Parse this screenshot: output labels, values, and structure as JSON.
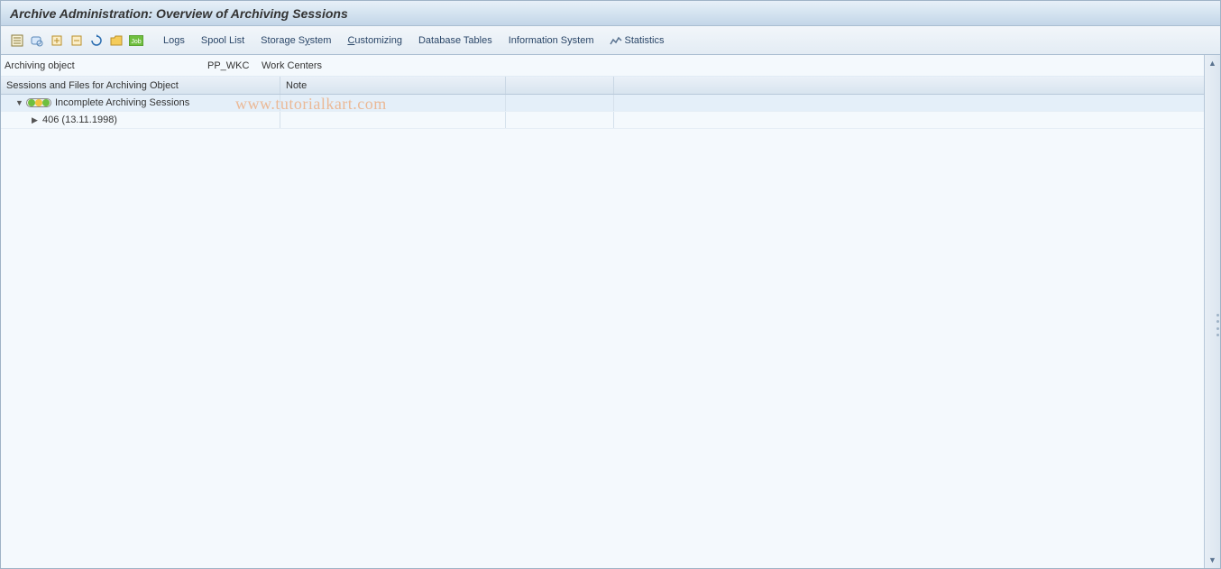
{
  "title": "Archive Administration: Overview of Archiving Sessions",
  "toolbar": {
    "text_items": [
      {
        "label": "Logs",
        "under_idx": -1
      },
      {
        "label": "Spool List",
        "under_idx": -1
      },
      {
        "label": "Storage System",
        "under_idx": 8
      },
      {
        "label": "Customizing",
        "under_idx": 0
      },
      {
        "label": "Database Tables",
        "under_idx": -1
      },
      {
        "label": "Information System",
        "under_idx": -1
      }
    ],
    "stats_label": "Statistics"
  },
  "info": {
    "label": "Archiving object",
    "code": "PP_WKC",
    "desc": "Work Centers"
  },
  "columns": {
    "c1": "Sessions and Files for Archiving Object",
    "c2": "Note"
  },
  "rows": [
    {
      "kind": "folder",
      "label": "Incomplete Archiving Sessions",
      "selected": true
    },
    {
      "kind": "item",
      "label": "406 (13.11.1998)",
      "selected": false
    }
  ],
  "watermark": "www.tutorialkart.com"
}
